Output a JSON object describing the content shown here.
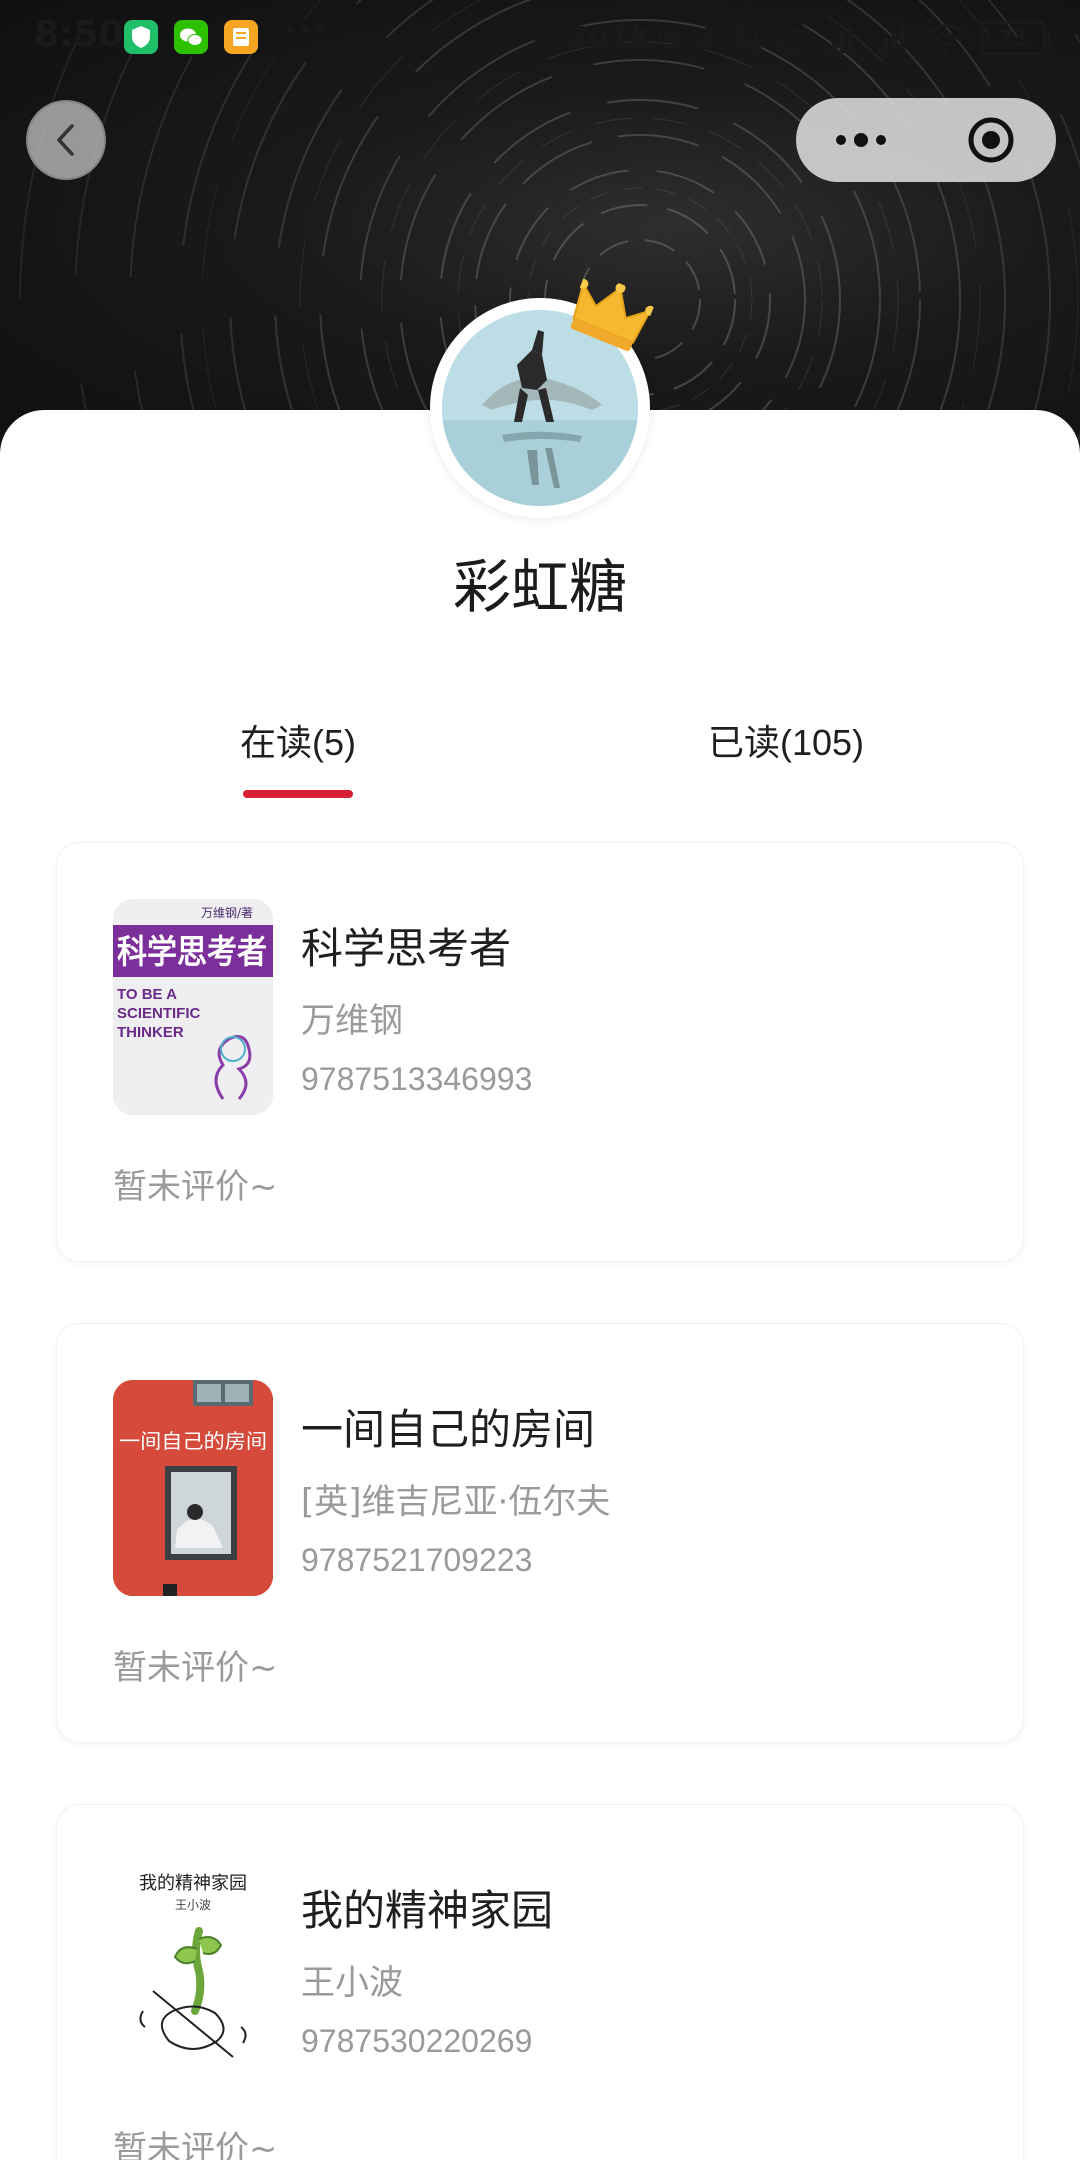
{
  "status_bar": {
    "time": "8:50",
    "more": "···",
    "net_speed": "401K/s",
    "battery": "73"
  },
  "profile": {
    "username": "彩虹糖",
    "badge_icon": "crown-icon"
  },
  "tabs": [
    {
      "label": "在读(5)",
      "active": true
    },
    {
      "label": "已读(105)",
      "active": false
    }
  ],
  "colors": {
    "accent": "#d81e32",
    "secondary_text": "#9a9a9a",
    "primary_text": "#1f1f1f"
  },
  "books": [
    {
      "title": "科学思考者",
      "author": "万维钢",
      "isbn": "9787513346993",
      "review": "暂未评价~",
      "cover": {
        "author_line": "万维钢/著",
        "title": "科学思考者",
        "english": [
          "TO BE A",
          "SCIENTIFIC",
          "THINKER"
        ]
      }
    },
    {
      "title": "一间自己的房间",
      "author": "[英]维吉尼亚·伍尔夫",
      "isbn": "9787521709223",
      "review": "暂未评价~",
      "cover": {
        "title": "一间自己的房间"
      }
    },
    {
      "title": "我的精神家园",
      "author": "王小波",
      "isbn": "9787530220269",
      "review": "暂未评价~",
      "cover": {
        "title": "我的精神家园",
        "author_line": "王小波"
      }
    }
  ]
}
